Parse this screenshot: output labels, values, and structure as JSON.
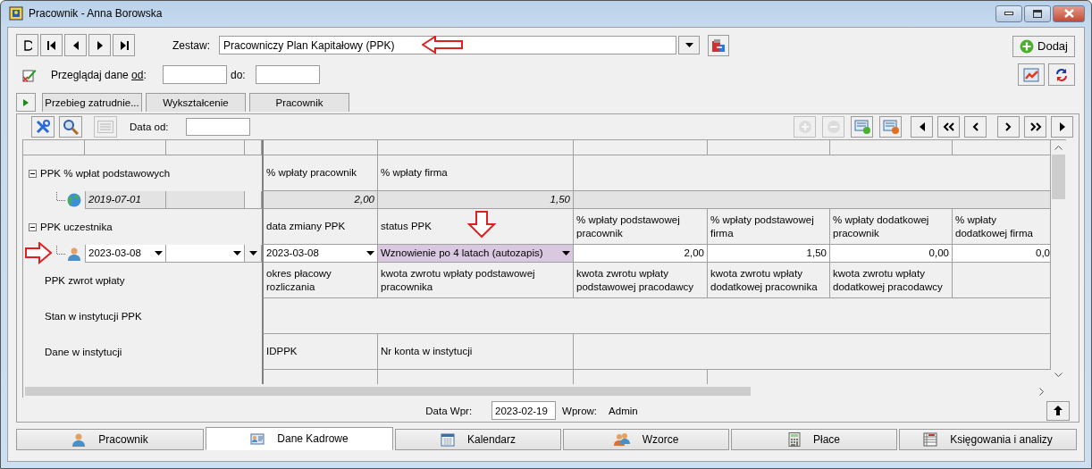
{
  "window": {
    "title": "Pracownik - Anna Borowska"
  },
  "toolbar": {
    "set_label": "Zestaw:",
    "set_value": "Pracowniczy Plan Kapitałowy (PPK)",
    "add_button": "Dodaj"
  },
  "filter": {
    "label": "Przeglądaj dane ",
    "label_key": "od",
    "label_end": ":",
    "to_label": "do:"
  },
  "subtabs": [
    {
      "label": "Przebieg zatrudnie...",
      "selected": false
    },
    {
      "label": "Wykształcenie",
      "selected": false
    },
    {
      "label": "Pracownik",
      "selected": false
    }
  ],
  "grid": {
    "date_label": "Data od:",
    "rows": [
      {
        "kind": "group",
        "label": "PPK % wpłat podstawowych",
        "expanded": true,
        "cells": [
          {
            "text": "% wpłaty pracownik"
          },
          {
            "text": "% wpłaty firma"
          }
        ]
      },
      {
        "kind": "entry",
        "date": "2019-07-01",
        "editable": false,
        "cells": [
          {
            "text": "2,00",
            "kind": "number",
            "highlighted": false
          },
          {
            "text": "1,50",
            "kind": "number",
            "highlighted": false
          }
        ]
      },
      {
        "kind": "group",
        "label": "PPK uczestnika",
        "expanded": true,
        "cells": [
          {
            "text": "data zmiany PPK"
          },
          {
            "text": "status PPK"
          },
          {
            "text": "% wpłaty podstawowej pracownik"
          },
          {
            "text": "% wpłaty podstawowej firma"
          },
          {
            "text": "% wpłaty dodatkowej pracownik"
          },
          {
            "text": "% wpłaty dodatkowej firma"
          }
        ]
      },
      {
        "kind": "entry",
        "date": "2023-03-08",
        "editable": true,
        "cells": [
          {
            "text": "2023-03-08",
            "kind": "dropdown",
            "highlighted": false
          },
          {
            "text": "Wznowienie po 4 latach (autozapis)",
            "kind": "dropdown",
            "highlighted": true
          },
          {
            "text": "2,00",
            "kind": "number",
            "highlighted": false
          },
          {
            "text": "1,50",
            "kind": "number",
            "highlighted": false
          },
          {
            "text": "0,00",
            "kind": "number",
            "highlighted": false
          },
          {
            "text": "0,0",
            "kind": "number",
            "highlighted": false
          }
        ]
      },
      {
        "kind": "section",
        "label": "PPK zwrot wpłaty",
        "cells": [
          {
            "text": "okres płacowy rozliczania"
          },
          {
            "text": "kwota zwrotu wpłaty podstawowej pracownika"
          },
          {
            "text": "kwota zwrotu wpłaty podstawowej pracodawcy"
          },
          {
            "text": "kwota zwrotu wpłaty dodatkowej pracownika"
          },
          {
            "text": "kwota zwrotu wpłaty dodatkowej pracodawcy"
          }
        ]
      },
      {
        "kind": "section",
        "label": "Stan w instytucji PPK",
        "cells": []
      },
      {
        "kind": "section",
        "label": "Dane w instytucji",
        "cells": [
          {
            "text": "IDPPK"
          },
          {
            "text": "Nr konta w instytucji"
          }
        ]
      }
    ]
  },
  "annotations": [
    {
      "kind": "left-arrow"
    },
    {
      "kind": "down-arrow"
    },
    {
      "kind": "right-arrow"
    }
  ],
  "footer": {
    "entry_date_label": "Data Wpr:",
    "entry_date": "2023-02-19",
    "entered_by_label": "Wprow:",
    "entered_by": "Admin"
  },
  "tabs": [
    {
      "label": "Pracownik",
      "selected": false
    },
    {
      "label": "Dane Kadrowe",
      "selected": true
    },
    {
      "label": "Kalendarz",
      "selected": false
    },
    {
      "label": "Wzorce",
      "selected": false
    },
    {
      "label": "Płace",
      "selected": false
    },
    {
      "label": "Księgowania i analizy",
      "selected": false
    }
  ]
}
